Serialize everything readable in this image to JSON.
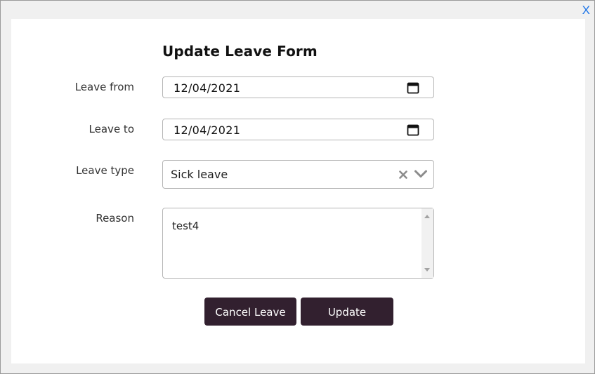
{
  "window": {
    "close_label": "X"
  },
  "form": {
    "title": "Update Leave Form",
    "leave_from": {
      "label": "Leave from",
      "value": "12/04/2021"
    },
    "leave_to": {
      "label": "Leave to",
      "value": "12/04/2021"
    },
    "leave_type": {
      "label": "Leave type",
      "value": "Sick leave"
    },
    "reason": {
      "label": "Reason",
      "value": "test4"
    },
    "buttons": {
      "cancel_label": "Cancel Leave",
      "update_label": "Update"
    }
  },
  "icons": {
    "date_picker": "calendar-icon",
    "clear": "clear-icon",
    "dropdown": "chevron-down-icon"
  },
  "colors": {
    "button_bg": "#32202f",
    "close_link": "#1a73e8",
    "backdrop": "#f0f0f0"
  }
}
